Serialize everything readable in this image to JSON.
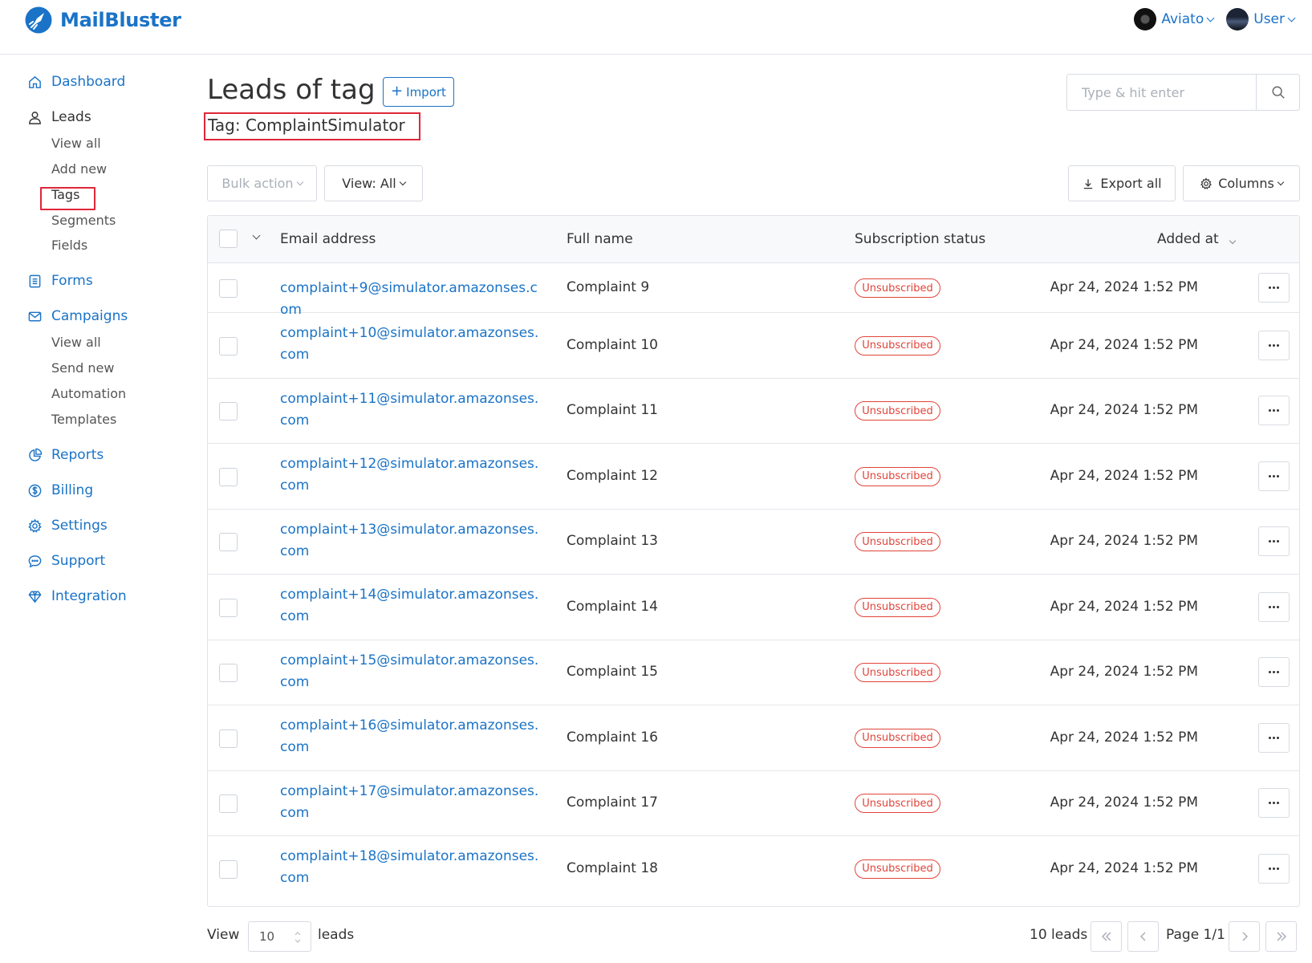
{
  "header": {
    "brand": "MailBluster",
    "accounts": [
      {
        "name": "Aviato"
      },
      {
        "name": "User"
      }
    ]
  },
  "sidebar": {
    "items": [
      {
        "label": "Dashboard",
        "icon": "home-icon"
      },
      {
        "label": "Leads",
        "icon": "user-icon",
        "sub": [
          "View all",
          "Add new",
          "Tags",
          "Segments",
          "Fields"
        ]
      },
      {
        "label": "Forms",
        "icon": "form-icon"
      },
      {
        "label": "Campaigns",
        "icon": "envelope-icon",
        "sub": [
          "View all",
          "Send new",
          "Automation",
          "Templates"
        ]
      },
      {
        "label": "Reports",
        "icon": "pie-chart-icon"
      },
      {
        "label": "Billing",
        "icon": "dollar-icon"
      },
      {
        "label": "Settings",
        "icon": "gear-icon"
      },
      {
        "label": "Support",
        "icon": "chat-icon"
      },
      {
        "label": "Integration",
        "icon": "diamond-icon"
      }
    ]
  },
  "main": {
    "title": "Leads of tag",
    "import_label": "Import",
    "tag_subtitle": "Tag: ComplaintSimulator",
    "search_placeholder": "Type & hit enter",
    "bulk_action": "Bulk action",
    "view_filter": "View: All",
    "export_all": "Export all",
    "columns": "Columns"
  },
  "table": {
    "headers": {
      "email": "Email address",
      "name": "Full name",
      "status": "Subscription status",
      "added": "Added at"
    },
    "rows": [
      {
        "email": "complaint+9@simulator.amazonses.com",
        "name": "Complaint 9",
        "status": "Unsubscribed",
        "added": "Apr 24, 2024 1:52 PM"
      },
      {
        "email": "complaint+10@simulator.amazonses.com",
        "name": "Complaint 10",
        "status": "Unsubscribed",
        "added": "Apr 24, 2024 1:52 PM"
      },
      {
        "email": "complaint+11@simulator.amazonses.com",
        "name": "Complaint 11",
        "status": "Unsubscribed",
        "added": "Apr 24, 2024 1:52 PM"
      },
      {
        "email": "complaint+12@simulator.amazonses.com",
        "name": "Complaint 12",
        "status": "Unsubscribed",
        "added": "Apr 24, 2024 1:52 PM"
      },
      {
        "email": "complaint+13@simulator.amazonses.com",
        "name": "Complaint 13",
        "status": "Unsubscribed",
        "added": "Apr 24, 2024 1:52 PM"
      },
      {
        "email": "complaint+14@simulator.amazonses.com",
        "name": "Complaint 14",
        "status": "Unsubscribed",
        "added": "Apr 24, 2024 1:52 PM"
      },
      {
        "email": "complaint+15@simulator.amazonses.com",
        "name": "Complaint 15",
        "status": "Unsubscribed",
        "added": "Apr 24, 2024 1:52 PM"
      },
      {
        "email": "complaint+16@simulator.amazonses.com",
        "name": "Complaint 16",
        "status": "Unsubscribed",
        "added": "Apr 24, 2024 1:52 PM"
      },
      {
        "email": "complaint+17@simulator.amazonses.com",
        "name": "Complaint 17",
        "status": "Unsubscribed",
        "added": "Apr 24, 2024 1:52 PM"
      },
      {
        "email": "complaint+18@simulator.amazonses.com",
        "name": "Complaint 18",
        "status": "Unsubscribed",
        "added": "Apr 24, 2024 1:52 PM"
      }
    ]
  },
  "footer": {
    "view_label": "View",
    "per_page": "10",
    "leads_label": "leads",
    "count": "10 leads",
    "page": "Page 1/1"
  },
  "colors": {
    "accent": "#1a73c7",
    "highlight": "#e0263a",
    "badge": "#e0443a"
  }
}
